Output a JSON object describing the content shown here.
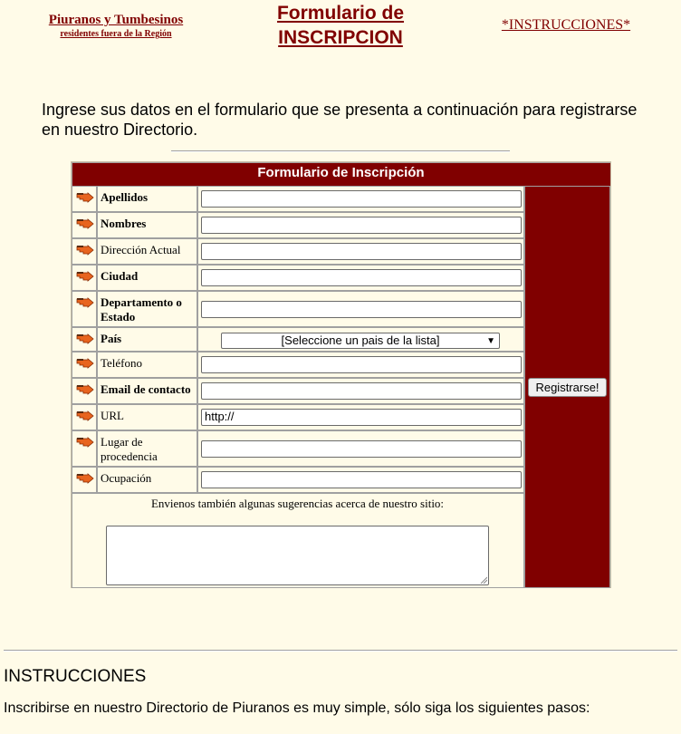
{
  "header": {
    "site_name": "Piuranos y Tumbesinos",
    "site_subtitle": "residentes fuera de la Región",
    "page_title": "Formulario de INSCRIPCION",
    "instructions_link": "*INSTRUCCIONES*"
  },
  "intro_text": "Ingrese sus datos en el formulario que se presenta a continuación para registrarse en nuestro Directorio.",
  "form": {
    "title": "Formulario de Inscripción",
    "fields": [
      {
        "label": "Apellidos",
        "bold": true,
        "value": ""
      },
      {
        "label": "Nombres",
        "bold": true,
        "value": ""
      },
      {
        "label": "Dirección Actual",
        "bold": false,
        "value": ""
      },
      {
        "label": "Ciudad",
        "bold": true,
        "value": ""
      },
      {
        "label": "Departamento o Estado",
        "bold": true,
        "value": ""
      },
      {
        "label": "País",
        "bold": true,
        "value": "[Seleccione un pais de la lista]"
      },
      {
        "label": "Teléfono",
        "bold": false,
        "value": ""
      },
      {
        "label": "Email de contacto",
        "bold": true,
        "value": ""
      },
      {
        "label": "URL",
        "bold": false,
        "value": "http://"
      },
      {
        "label": "Lugar de procedencia",
        "bold": false,
        "value": ""
      },
      {
        "label": "Ocupación",
        "bold": false,
        "value": ""
      }
    ],
    "submit_label": "Registrarse!",
    "suggestions_label": "Envienos también algunas sugerencias acerca de nuestro sitio:",
    "suggestions_value": ""
  },
  "instructions": {
    "heading": "INSTRUCCIONES",
    "text": "Inscribirse en nuestro Directorio de Piuranos es muy simple, sólo siga los siguientes pasos:"
  },
  "colors": {
    "brand": "#800000",
    "background": "#fffbe8",
    "bullet": "#e8641e"
  },
  "icons": {
    "field_bullet": "pointing-hand-icon"
  }
}
